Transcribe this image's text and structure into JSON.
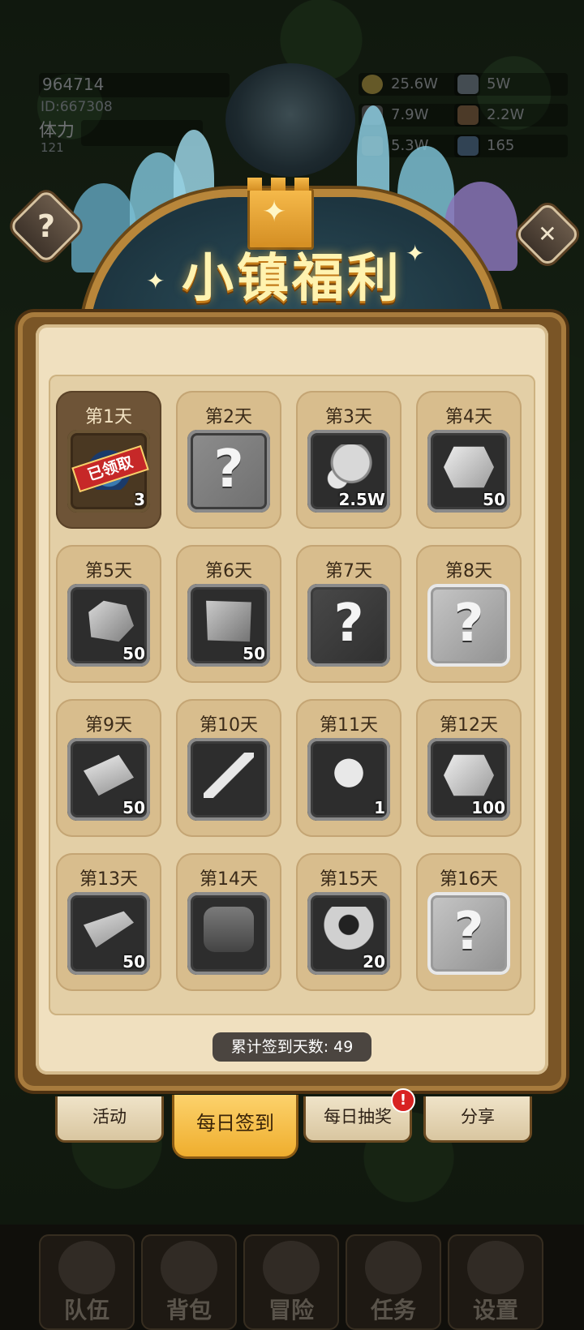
{
  "player": {
    "name": "964714",
    "id": "ID:667308",
    "stamina_label": "体力",
    "stamina_value": "121"
  },
  "resources": [
    {
      "name": "gold",
      "value": "25.6W",
      "color": "#b8a24a"
    },
    {
      "name": "iron",
      "value": "5W",
      "color": "#7c8a96"
    },
    {
      "name": "stone",
      "value": "7.9W",
      "color": "#6a6a6a"
    },
    {
      "name": "cloth",
      "value": "2.2W",
      "color": "#8a6a4a"
    },
    {
      "name": "wood",
      "value": "5.3W",
      "color": "#7a5a34"
    },
    {
      "name": "crystal",
      "value": "165",
      "color": "#5a7a9a"
    }
  ],
  "header": {
    "title": "小镇福利",
    "help_icon": "question-icon",
    "close_icon": "close-icon",
    "help_symbol": "?",
    "close_symbol": "✕"
  },
  "days": [
    {
      "label": "第1天",
      "item": "potion",
      "qty": "3",
      "status": "已领取",
      "claimed": true
    },
    {
      "label": "第2天",
      "item": "unknown",
      "qty": "",
      "symbol": "?"
    },
    {
      "label": "第3天",
      "item": "coin-bag",
      "qty": "2.5W"
    },
    {
      "label": "第4天",
      "item": "crystal-ore",
      "qty": "50"
    },
    {
      "label": "第5天",
      "item": "stone-ore",
      "qty": "50"
    },
    {
      "label": "第6天",
      "item": "cloth",
      "qty": "50"
    },
    {
      "label": "第7天",
      "item": "unknown",
      "qty": "",
      "symbol": "?"
    },
    {
      "label": "第8天",
      "item": "unknown",
      "qty": "",
      "symbol": "?"
    },
    {
      "label": "第9天",
      "item": "iron-ingot",
      "qty": "50"
    },
    {
      "label": "第10天",
      "item": "sword",
      "qty": ""
    },
    {
      "label": "第11天",
      "item": "feather",
      "qty": "1"
    },
    {
      "label": "第12天",
      "item": "crystal-ore",
      "qty": "100"
    },
    {
      "label": "第13天",
      "item": "log",
      "qty": "50"
    },
    {
      "label": "第14天",
      "item": "backpack",
      "qty": ""
    },
    {
      "label": "第15天",
      "item": "rune-stone",
      "qty": "20"
    },
    {
      "label": "第16天",
      "item": "unknown",
      "qty": "",
      "symbol": "?"
    }
  ],
  "counter": "累计签到天数: 49",
  "tabs": [
    {
      "label": "活动",
      "active": false
    },
    {
      "label": "每日签到",
      "active": true
    },
    {
      "label": "每日抽奖",
      "active": false,
      "badge": "!"
    },
    {
      "label": "分享",
      "active": false
    }
  ],
  "nav": [
    {
      "label": "队伍",
      "icon": "helmet-icon"
    },
    {
      "label": "背包",
      "icon": "bag-icon"
    },
    {
      "label": "冒险",
      "icon": "swords-icon"
    },
    {
      "label": "任务",
      "icon": "quest-icon"
    },
    {
      "label": "设置",
      "icon": "gear-icon"
    }
  ],
  "colors": {
    "accent": "#f0b23a",
    "panel": "#f0e0bf",
    "stamp": "#c62828"
  }
}
